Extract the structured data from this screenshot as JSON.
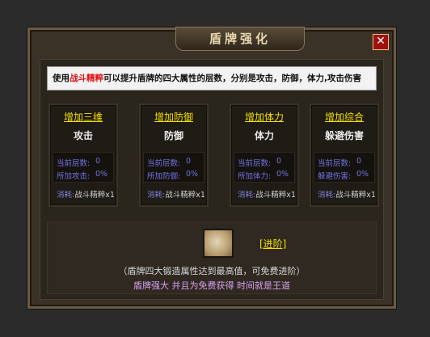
{
  "window": {
    "title": "盾牌强化",
    "close_label": "✕"
  },
  "description": {
    "prefix": "使用",
    "highlight": "战斗精粹",
    "suffix": "可以提升盾牌的四大属性的层数，分别是攻击，防御，体力,攻击伤害"
  },
  "cards": [
    {
      "title": "增加三维",
      "attr": "攻击",
      "row1_label": "当前层数:",
      "row1_value": "0",
      "row2_label": "所加攻击:",
      "row2_value": "0%",
      "cost_label": "消耗:",
      "cost_value": "战斗精粹x1"
    },
    {
      "title": "增加防御",
      "attr": "防御",
      "row1_label": "当前层数:",
      "row1_value": "0",
      "row2_label": "所加防御:",
      "row2_value": "0%",
      "cost_label": "消耗:",
      "cost_value": "战斗精粹x1"
    },
    {
      "title": "增加体力",
      "attr": "体力",
      "row1_label": "当前层数:",
      "row1_value": "0",
      "row2_label": "所加体力:",
      "row2_value": "0%",
      "cost_label": "消耗:",
      "cost_value": "战斗精粹x1"
    },
    {
      "title": "增加综合",
      "attr": "躲避伤害",
      "row1_label": "当前层数:",
      "row1_value": "0",
      "row2_label": "躲避伤害:",
      "row2_value": "0%",
      "cost_label": "消耗:",
      "cost_value": "战斗精粹x1"
    }
  ],
  "advance": {
    "label": "[进阶]"
  },
  "notes": {
    "line1": "（盾牌四大锻造属性达到最高值，可免费进阶）",
    "line2": "盾牌强大 并且为免费获得 时间就是王道"
  }
}
